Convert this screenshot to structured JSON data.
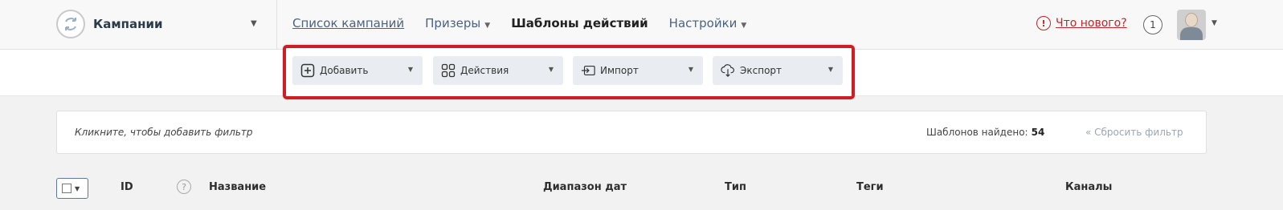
{
  "brand": {
    "title": "Кампании"
  },
  "nav": {
    "items": [
      {
        "label": "Список кампаний"
      },
      {
        "label": "Призеры"
      },
      {
        "label": "Шаблоны действий"
      },
      {
        "label": "Настройки"
      }
    ]
  },
  "header": {
    "whats_new": "Что нового?",
    "whats_new_icon": "!",
    "notifications_count": "1"
  },
  "toolbar": {
    "add_label": "Добавить",
    "actions_label": "Действия",
    "import_label": "Импорт",
    "export_label": "Экспорт",
    "highlight_color": "#cc1f25"
  },
  "filter": {
    "hint": "Кликните, чтобы добавить фильтр",
    "found_label": "Шаблонов найдено:",
    "found_count": "54",
    "reset": "« Сбросить фильтр"
  },
  "table": {
    "columns": [
      "ID",
      "Название",
      "Диапазон дат",
      "Тип",
      "Теги",
      "Каналы"
    ],
    "help_icon": "?"
  }
}
